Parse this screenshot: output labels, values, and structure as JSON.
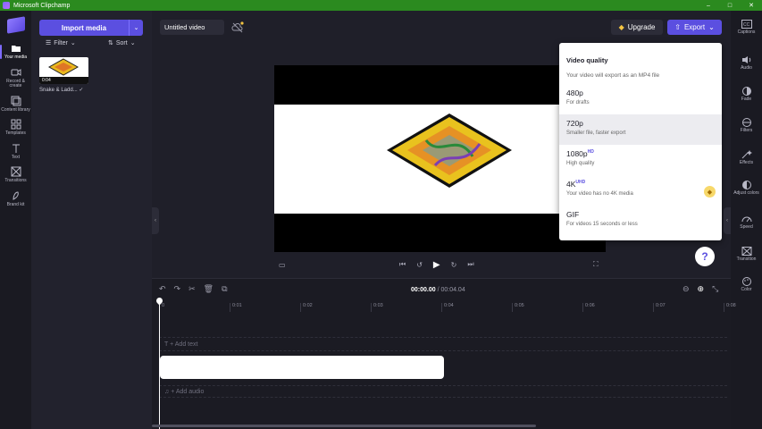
{
  "window": {
    "title": "Microsoft Clipchamp",
    "controls": [
      "–",
      "□",
      "✕"
    ]
  },
  "leftnav": [
    {
      "label": "Your media"
    },
    {
      "label": "Record & create"
    },
    {
      "label": "Content library"
    },
    {
      "label": "Templates"
    },
    {
      "label": "Text"
    },
    {
      "label": "Transitions"
    },
    {
      "label": "Brand kit"
    }
  ],
  "media": {
    "import_label": "Import media",
    "filter_label": "Filter",
    "sort_label": "Sort",
    "thumb_duration": "0:04",
    "thumb_name": "Snake & Ladd... ✓"
  },
  "header": {
    "video_title": "Untitled video",
    "upgrade_label": "Upgrade",
    "export_label": "Export"
  },
  "export_menu": {
    "heading": "Video quality",
    "subtitle": "Your video will export as an MP4 file",
    "options": [
      {
        "name": "480p",
        "badge": "",
        "desc": "For drafts"
      },
      {
        "name": "720p",
        "badge": "",
        "desc": "Smaller file, faster export"
      },
      {
        "name": "1080p",
        "badge": "HD",
        "desc": "High quality"
      },
      {
        "name": "4K",
        "badge": "UHD",
        "desc": "Your video has no 4K media"
      },
      {
        "name": "GIF",
        "badge": "",
        "desc": "For videos 15 seconds or less"
      }
    ],
    "highlighted_index": 1
  },
  "help_label": "?",
  "rightnav": [
    {
      "label": "Captions"
    },
    {
      "label": "Audio"
    },
    {
      "label": "Fade"
    },
    {
      "label": "Filters"
    },
    {
      "label": "Effects"
    },
    {
      "label": "Adjust colors"
    },
    {
      "label": "Speed"
    },
    {
      "label": "Transition"
    },
    {
      "label": "Color"
    }
  ],
  "timeline": {
    "current_time": "00:00.00",
    "total_time": " / 00:04.04",
    "ticks": [
      "0",
      "0:01",
      "0:02",
      "0:03",
      "0:04",
      "0:05",
      "0:06",
      "0:07",
      "0:08"
    ],
    "add_text": "+ Add text",
    "add_audio": "+ Add audio"
  },
  "colors": {
    "accent": "#5b4fe0",
    "titlebar": "#2b8a1f",
    "background": "#1f1f29"
  }
}
